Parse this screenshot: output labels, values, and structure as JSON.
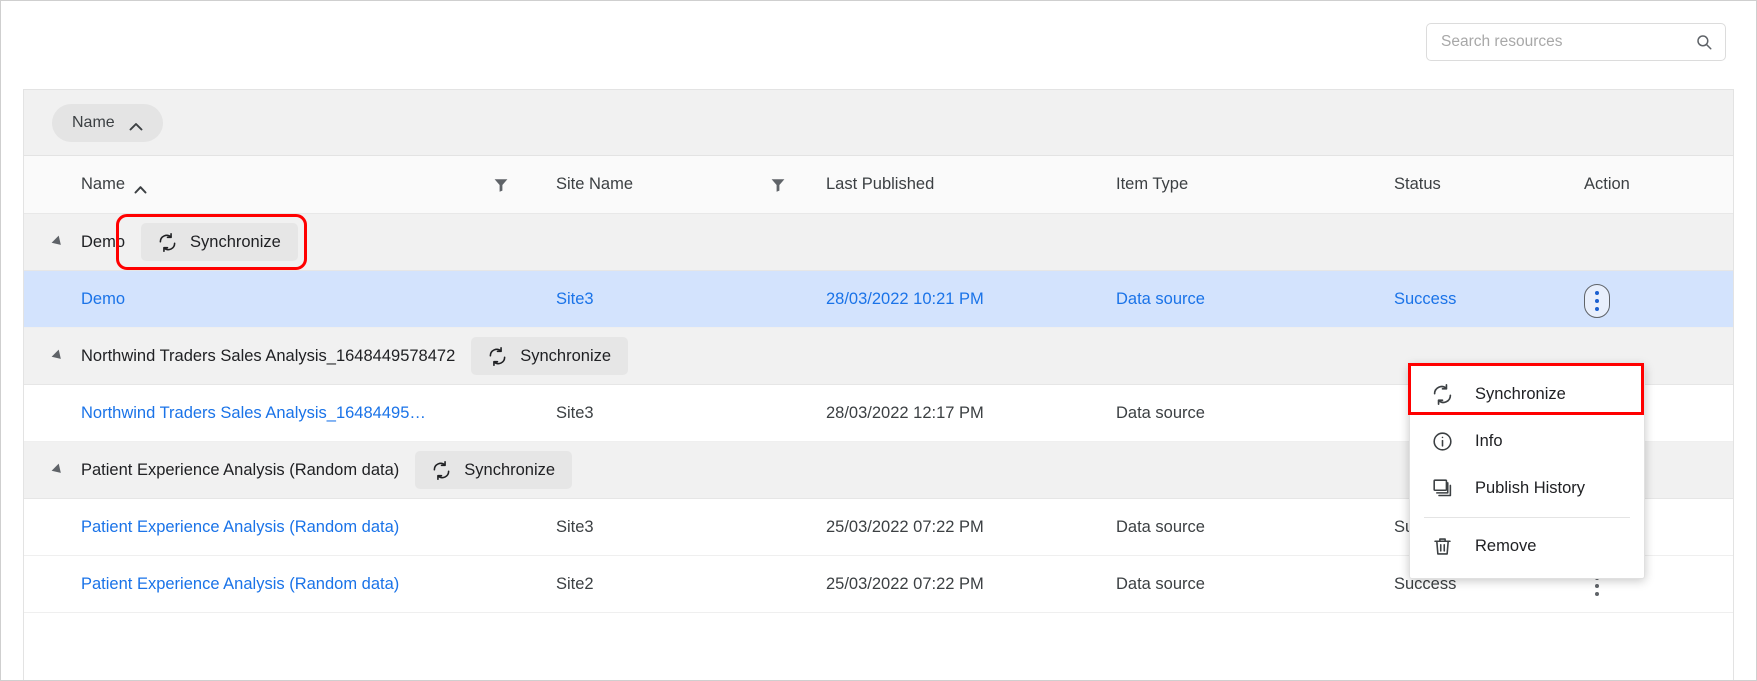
{
  "search": {
    "placeholder": "Search resources",
    "value": "",
    "icon": "search-icon"
  },
  "groupbar": {
    "chip_label": "Name",
    "chip_sort_icon": "caret-up-icon"
  },
  "table": {
    "columns": [
      {
        "label": "Name",
        "sort": "asc",
        "sort_icon": "caret-up-icon"
      },
      {
        "label": "",
        "filter_icon": "filter-icon"
      },
      {
        "label": "Site Name"
      },
      {
        "label": "",
        "filter_icon": "filter-icon"
      },
      {
        "label": "Last Published"
      },
      {
        "label": "Item Type"
      },
      {
        "label": "Status"
      },
      {
        "label": "Action"
      }
    ],
    "groups": [
      {
        "label": "Demo",
        "sync_label": "Synchronize",
        "highlighted": true,
        "rows": [
          {
            "name": "Demo",
            "site": "Site3",
            "published": "28/03/2022 10:21 PM",
            "type": "Data source",
            "status": "Success",
            "selected": true,
            "menu_open": true
          }
        ]
      },
      {
        "label": "Northwind Traders Sales Analysis_1648449578472",
        "sync_label": "Synchronize",
        "highlighted": false,
        "rows": [
          {
            "name": "Northwind Traders Sales Analysis_16484495…",
            "site": "Site3",
            "published": "28/03/2022 12:17 PM",
            "type": "Data source",
            "status": "",
            "selected": false,
            "menu_open": false
          }
        ]
      },
      {
        "label": "Patient Experience Analysis (Random data)",
        "sync_label": "Synchronize",
        "highlighted": false,
        "rows": [
          {
            "name": "Patient Experience Analysis (Random data)",
            "site": "Site3",
            "published": "25/03/2022 07:22 PM",
            "type": "Data source",
            "status": "Success",
            "selected": false,
            "menu_open": false
          },
          {
            "name": "Patient Experience Analysis (Random data)",
            "site": "Site2",
            "published": "25/03/2022 07:22 PM",
            "type": "Data source",
            "status": "Success",
            "selected": false,
            "menu_open": false
          }
        ]
      }
    ]
  },
  "context_menu": {
    "items": [
      {
        "label": "Synchronize",
        "icon": "sync-icon",
        "highlighted": true
      },
      {
        "label": "Info",
        "icon": "info-icon",
        "highlighted": false
      },
      {
        "label": "Publish History",
        "icon": "copies-icon",
        "highlighted": false
      },
      {
        "label": "Remove",
        "icon": "trash-icon",
        "highlighted": false
      }
    ],
    "separator_before_index": 3
  },
  "colors": {
    "link": "#1a73e8",
    "selected_row": "#d3e3fd",
    "highlight": "#ff0000",
    "group_bg": "#f1f1f1",
    "chip_bg": "#e4e4e4"
  }
}
